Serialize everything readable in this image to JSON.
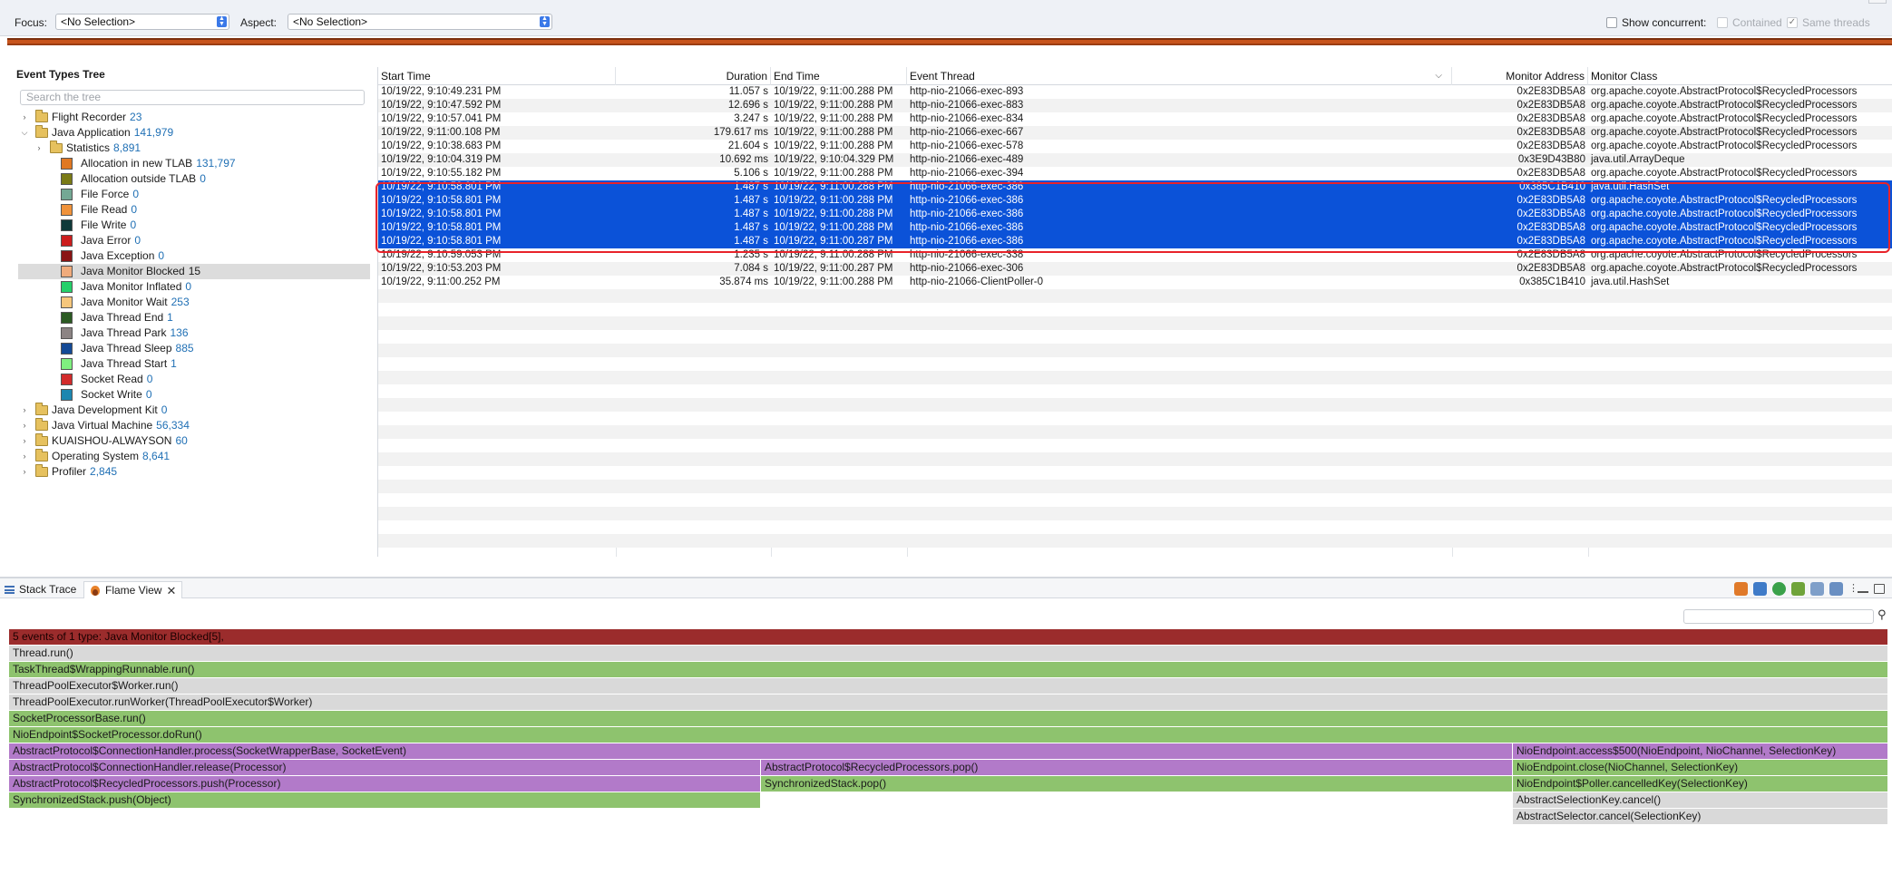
{
  "toolbar": {
    "focus_label": "Focus:",
    "focus_value": "<No Selection>",
    "aspect_label": "Aspect:",
    "aspect_value": "<No Selection>",
    "show_concurrent": "Show concurrent:",
    "contained": "Contained",
    "same_threads": "Same threads"
  },
  "tree": {
    "title": "Event Types Tree",
    "search_placeholder": "Search the tree",
    "items": [
      {
        "label": "Flight Recorder",
        "count": "23",
        "kind": "folder",
        "level": 0,
        "expanded": false
      },
      {
        "label": "Java Application",
        "count": "141,979",
        "kind": "folder",
        "level": 0,
        "expanded": true
      },
      {
        "label": "Statistics",
        "count": "8,891",
        "kind": "folder",
        "level": 1,
        "expanded": false
      },
      {
        "label": "Allocation in new TLAB",
        "count": "131,797",
        "kind": "type",
        "level": 2,
        "color": "#e07822"
      },
      {
        "label": "Allocation outside TLAB",
        "count": "0",
        "kind": "type",
        "level": 2,
        "color": "#7a7a16"
      },
      {
        "label": "File Force",
        "count": "0",
        "kind": "type",
        "level": 2,
        "color": "#74a894"
      },
      {
        "label": "File Read",
        "count": "0",
        "kind": "type",
        "level": 2,
        "color": "#f0923a"
      },
      {
        "label": "File Write",
        "count": "0",
        "kind": "type",
        "level": 2,
        "color": "#0f3a3a"
      },
      {
        "label": "Java Error",
        "count": "0",
        "kind": "type",
        "level": 2,
        "color": "#cc1d1d"
      },
      {
        "label": "Java Exception",
        "count": "0",
        "kind": "type",
        "level": 2,
        "color": "#8a1414"
      },
      {
        "label": "Java Monitor Blocked",
        "count": "15",
        "kind": "type",
        "level": 2,
        "color": "#f0ab7c",
        "selected": true
      },
      {
        "label": "Java Monitor Inflated",
        "count": "0",
        "kind": "type",
        "level": 2,
        "color": "#25d06a"
      },
      {
        "label": "Java Monitor Wait",
        "count": "253",
        "kind": "type",
        "level": 2,
        "color": "#f6c77c"
      },
      {
        "label": "Java Thread End",
        "count": "1",
        "kind": "type",
        "level": 2,
        "color": "#2b5a22"
      },
      {
        "label": "Java Thread Park",
        "count": "136",
        "kind": "type",
        "level": 2,
        "color": "#8c8484"
      },
      {
        "label": "Java Thread Sleep",
        "count": "885",
        "kind": "type",
        "level": 2,
        "color": "#144a96"
      },
      {
        "label": "Java Thread Start",
        "count": "1",
        "kind": "type",
        "level": 2,
        "color": "#7ff07f"
      },
      {
        "label": "Socket Read",
        "count": "0",
        "kind": "type",
        "level": 2,
        "color": "#d22b2b"
      },
      {
        "label": "Socket Write",
        "count": "0",
        "kind": "type",
        "level": 2,
        "color": "#1c86b0"
      },
      {
        "label": "Java Development Kit",
        "count": "0",
        "kind": "folder",
        "level": 0,
        "expanded": false
      },
      {
        "label": "Java Virtual Machine",
        "count": "56,334",
        "kind": "folder",
        "level": 0,
        "expanded": false
      },
      {
        "label": "KUAISHOU-ALWAYSON",
        "count": "60",
        "kind": "folder",
        "level": 0,
        "expanded": false
      },
      {
        "label": "Operating System",
        "count": "8,641",
        "kind": "folder",
        "level": 0,
        "expanded": false
      },
      {
        "label": "Profiler",
        "count": "2,845",
        "kind": "folder",
        "level": 0,
        "expanded": false
      }
    ]
  },
  "table": {
    "columns": [
      "Start Time",
      "Duration",
      "End Time",
      "Event Thread",
      "Monitor Address",
      "Monitor Class"
    ],
    "rows": [
      {
        "start": "10/19/22, 9:10:49.231 PM",
        "duration": "11.057 s",
        "end": "10/19/22, 9:11:00.288 PM",
        "thread": "http-nio-21066-exec-893",
        "address": "0x2E83DB5A8",
        "cls": "org.apache.coyote.AbstractProtocol$RecycledProcessors",
        "selected": false
      },
      {
        "start": "10/19/22, 9:10:47.592 PM",
        "duration": "12.696 s",
        "end": "10/19/22, 9:11:00.288 PM",
        "thread": "http-nio-21066-exec-883",
        "address": "0x2E83DB5A8",
        "cls": "org.apache.coyote.AbstractProtocol$RecycledProcessors",
        "selected": false
      },
      {
        "start": "10/19/22, 9:10:57.041 PM",
        "duration": "3.247 s",
        "end": "10/19/22, 9:11:00.288 PM",
        "thread": "http-nio-21066-exec-834",
        "address": "0x2E83DB5A8",
        "cls": "org.apache.coyote.AbstractProtocol$RecycledProcessors",
        "selected": false
      },
      {
        "start": "10/19/22, 9:11:00.108 PM",
        "duration": "179.617 ms",
        "end": "10/19/22, 9:11:00.288 PM",
        "thread": "http-nio-21066-exec-667",
        "address": "0x2E83DB5A8",
        "cls": "org.apache.coyote.AbstractProtocol$RecycledProcessors",
        "selected": false
      },
      {
        "start": "10/19/22, 9:10:38.683 PM",
        "duration": "21.604 s",
        "end": "10/19/22, 9:11:00.288 PM",
        "thread": "http-nio-21066-exec-578",
        "address": "0x2E83DB5A8",
        "cls": "org.apache.coyote.AbstractProtocol$RecycledProcessors",
        "selected": false
      },
      {
        "start": "10/19/22, 9:10:04.319 PM",
        "duration": "10.692 ms",
        "end": "10/19/22, 9:10:04.329 PM",
        "thread": "http-nio-21066-exec-489",
        "address": "0x3E9D43B80",
        "cls": "java.util.ArrayDeque",
        "selected": false
      },
      {
        "start": "10/19/22, 9:10:55.182 PM",
        "duration": "5.106 s",
        "end": "10/19/22, 9:11:00.288 PM",
        "thread": "http-nio-21066-exec-394",
        "address": "0x2E83DB5A8",
        "cls": "org.apache.coyote.AbstractProtocol$RecycledProcessors",
        "selected": false
      },
      {
        "start": "10/19/22, 9:10:58.801 PM",
        "duration": "1.487 s",
        "end": "10/19/22, 9:11:00.288 PM",
        "thread": "http-nio-21066-exec-386",
        "address": "0x385C1B410",
        "cls": "java.util.HashSet",
        "selected": true
      },
      {
        "start": "10/19/22, 9:10:58.801 PM",
        "duration": "1.487 s",
        "end": "10/19/22, 9:11:00.288 PM",
        "thread": "http-nio-21066-exec-386",
        "address": "0x2E83DB5A8",
        "cls": "org.apache.coyote.AbstractProtocol$RecycledProcessors",
        "selected": true
      },
      {
        "start": "10/19/22, 9:10:58.801 PM",
        "duration": "1.487 s",
        "end": "10/19/22, 9:11:00.288 PM",
        "thread": "http-nio-21066-exec-386",
        "address": "0x2E83DB5A8",
        "cls": "org.apache.coyote.AbstractProtocol$RecycledProcessors",
        "selected": true
      },
      {
        "start": "10/19/22, 9:10:58.801 PM",
        "duration": "1.487 s",
        "end": "10/19/22, 9:11:00.288 PM",
        "thread": "http-nio-21066-exec-386",
        "address": "0x2E83DB5A8",
        "cls": "org.apache.coyote.AbstractProtocol$RecycledProcessors",
        "selected": true
      },
      {
        "start": "10/19/22, 9:10:58.801 PM",
        "duration": "1.487 s",
        "end": "10/19/22, 9:11:00.287 PM",
        "thread": "http-nio-21066-exec-386",
        "address": "0x2E83DB5A8",
        "cls": "org.apache.coyote.AbstractProtocol$RecycledProcessors",
        "selected": true
      },
      {
        "start": "10/19/22, 9:10:59.053 PM",
        "duration": "1.235 s",
        "end": "10/19/22, 9:11:00.288 PM",
        "thread": "http-nio-21066-exec-338",
        "address": "0x2E83DB5A8",
        "cls": "org.apache.coyote.AbstractProtocol$RecycledProcessors",
        "selected": false
      },
      {
        "start": "10/19/22, 9:10:53.203 PM",
        "duration": "7.084 s",
        "end": "10/19/22, 9:11:00.287 PM",
        "thread": "http-nio-21066-exec-306",
        "address": "0x2E83DB5A8",
        "cls": "org.apache.coyote.AbstractProtocol$RecycledProcessors",
        "selected": false
      },
      {
        "start": "10/19/22, 9:11:00.252 PM",
        "duration": "35.874 ms",
        "end": "10/19/22, 9:11:00.288 PM",
        "thread": "http-nio-21066-ClientPoller-0",
        "address": "0x385C1B410",
        "cls": "java.util.HashSet",
        "selected": false
      }
    ]
  },
  "bottom_tabs": {
    "stack_trace": "Stack Trace",
    "flame_view": "Flame View"
  },
  "flame": {
    "frames": [
      {
        "label": "5 events of 1 type: Java Monitor Blocked[5],",
        "row": 0,
        "start": 0.0,
        "end": 1.0,
        "color": "red"
      },
      {
        "label": "Thread.run()",
        "row": 1,
        "start": 0.0,
        "end": 1.0,
        "color": "gray"
      },
      {
        "label": "TaskThread$WrappingRunnable.run()",
        "row": 2,
        "start": 0.0,
        "end": 1.0,
        "color": "green"
      },
      {
        "label": "ThreadPoolExecutor$Worker.run()",
        "row": 3,
        "start": 0.0,
        "end": 1.0,
        "color": "gray"
      },
      {
        "label": "ThreadPoolExecutor.runWorker(ThreadPoolExecutor$Worker)",
        "row": 4,
        "start": 0.0,
        "end": 1.0,
        "color": "gray"
      },
      {
        "label": "SocketProcessorBase.run()",
        "row": 5,
        "start": 0.0,
        "end": 1.0,
        "color": "green"
      },
      {
        "label": "NioEndpoint$SocketProcessor.doRun()",
        "row": 6,
        "start": 0.0,
        "end": 1.0,
        "color": "green"
      },
      {
        "label": "AbstractProtocol$ConnectionHandler.process(SocketWrapperBase, SocketEvent)",
        "row": 7,
        "start": 0.0,
        "end": 0.8,
        "color": "purple"
      },
      {
        "label": "NioEndpoint.access$500(NioEndpoint, NioChannel, SelectionKey)",
        "row": 7,
        "start": 0.8,
        "end": 1.0,
        "color": "purple"
      },
      {
        "label": "AbstractProtocol$ConnectionHandler.release(Processor)",
        "row": 8,
        "start": 0.0,
        "end": 0.4,
        "color": "purple"
      },
      {
        "label": "AbstractProtocol$RecycledProcessors.pop()",
        "row": 8,
        "start": 0.4,
        "end": 0.8,
        "color": "purple"
      },
      {
        "label": "NioEndpoint.close(NioChannel, SelectionKey)",
        "row": 8,
        "start": 0.8,
        "end": 1.0,
        "color": "green"
      },
      {
        "label": "AbstractProtocol$RecycledProcessors.push(Processor)",
        "row": 9,
        "start": 0.0,
        "end": 0.4,
        "color": "purple"
      },
      {
        "label": "SynchronizedStack.pop()",
        "row": 9,
        "start": 0.4,
        "end": 0.8,
        "color": "green"
      },
      {
        "label": "NioEndpoint$Poller.cancelledKey(SelectionKey)",
        "row": 9,
        "start": 0.8,
        "end": 1.0,
        "color": "green"
      },
      {
        "label": "SynchronizedStack.push(Object)",
        "row": 10,
        "start": 0.0,
        "end": 0.4,
        "color": "green"
      },
      {
        "label": "AbstractSelectionKey.cancel()",
        "row": 10,
        "start": 0.8,
        "end": 1.0,
        "color": "gray"
      },
      {
        "label": "AbstractSelector.cancel(SelectionKey)",
        "row": 11,
        "start": 0.8,
        "end": 1.0,
        "color": "gray"
      }
    ]
  }
}
